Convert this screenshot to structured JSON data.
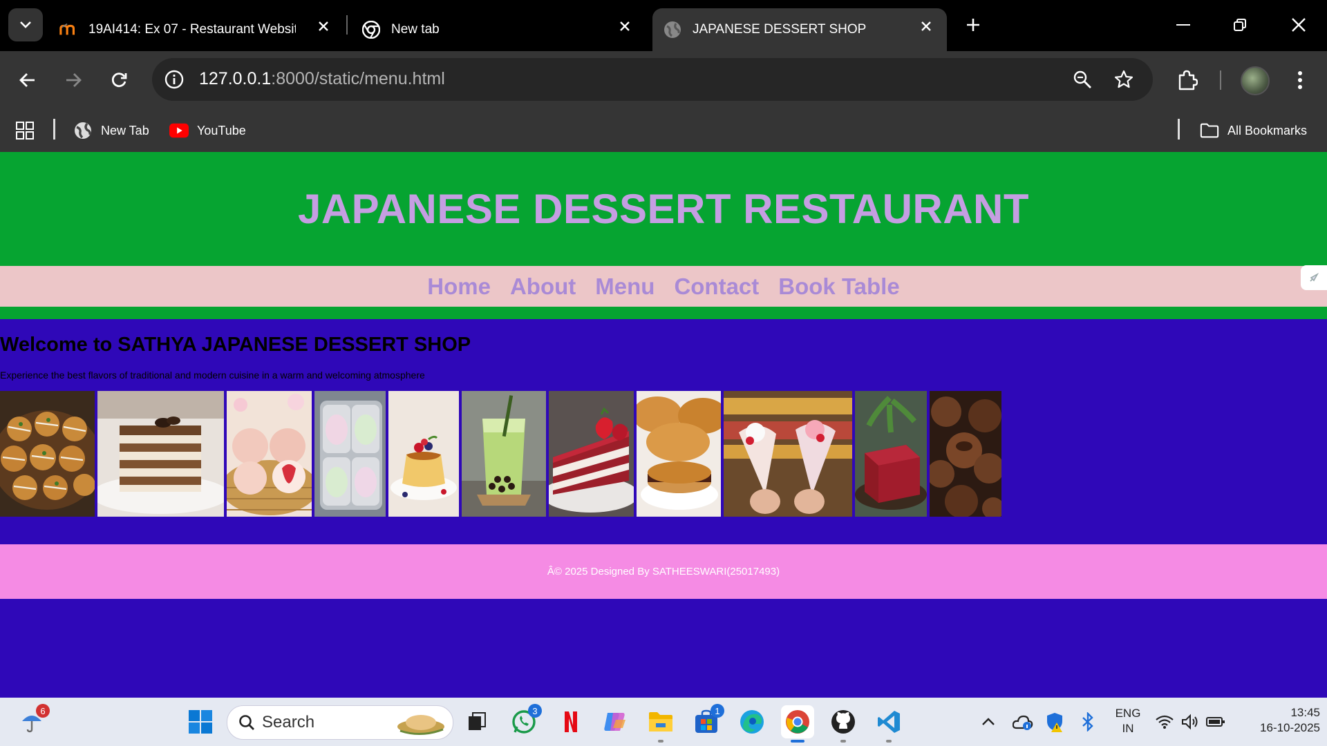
{
  "browser": {
    "tabs": [
      {
        "title": "19AI414: Ex 07 - Restaurant Website |",
        "icon": "moodle-icon",
        "active": false
      },
      {
        "title": "New tab",
        "icon": "chrome-icon",
        "active": false
      },
      {
        "title": "JAPANESE DESSERT SHOP",
        "icon": "globe-icon",
        "active": true
      }
    ],
    "address": {
      "host": "127.0.0.1",
      "path": ":8000/static/menu.html"
    },
    "bookmarks": [
      {
        "label": "New Tab",
        "icon": "globe-icon"
      },
      {
        "label": "YouTube",
        "icon": "youtube-icon"
      }
    ],
    "all_bookmarks_label": "All Bookmarks"
  },
  "page": {
    "header_title": "JAPANESE DESSERT RESTAURANT",
    "nav": [
      "Home",
      "About",
      "Menu",
      "Contact",
      "Book Table"
    ],
    "welcome_heading": "Welcome to SATHYA JAPANESE DESSERT SHOP",
    "welcome_text": "Experience the best flavors of traditional and modern cuisine in a warm and welcoming atmosphere",
    "gallery": [
      "takoyaki",
      "tiramisu",
      "strawberry mochi",
      "mochi box",
      "custard pudding",
      "matcha bubble tea",
      "strawberry cake",
      "dorayaki",
      "crepes",
      "red jelly cube",
      "chocolate truffles"
    ],
    "footer_text": "Â© 2025 Designed By SATHEESWARI(25017493)",
    "colors": {
      "header_bg": "#06a431",
      "title": "#c59ee2",
      "nav_bg": "#ecc6c8",
      "nav_link": "#a98ad6",
      "body_bg": "#2f08b8",
      "footer_bg": "#f58be4"
    }
  },
  "taskbar": {
    "weather_badge": "6",
    "search_label": "Search",
    "whatsapp_badge": "3",
    "store_badge": "1",
    "language": {
      "line1": "ENG",
      "line2": "IN"
    },
    "time": "13:45",
    "date": "16-10-2025"
  }
}
